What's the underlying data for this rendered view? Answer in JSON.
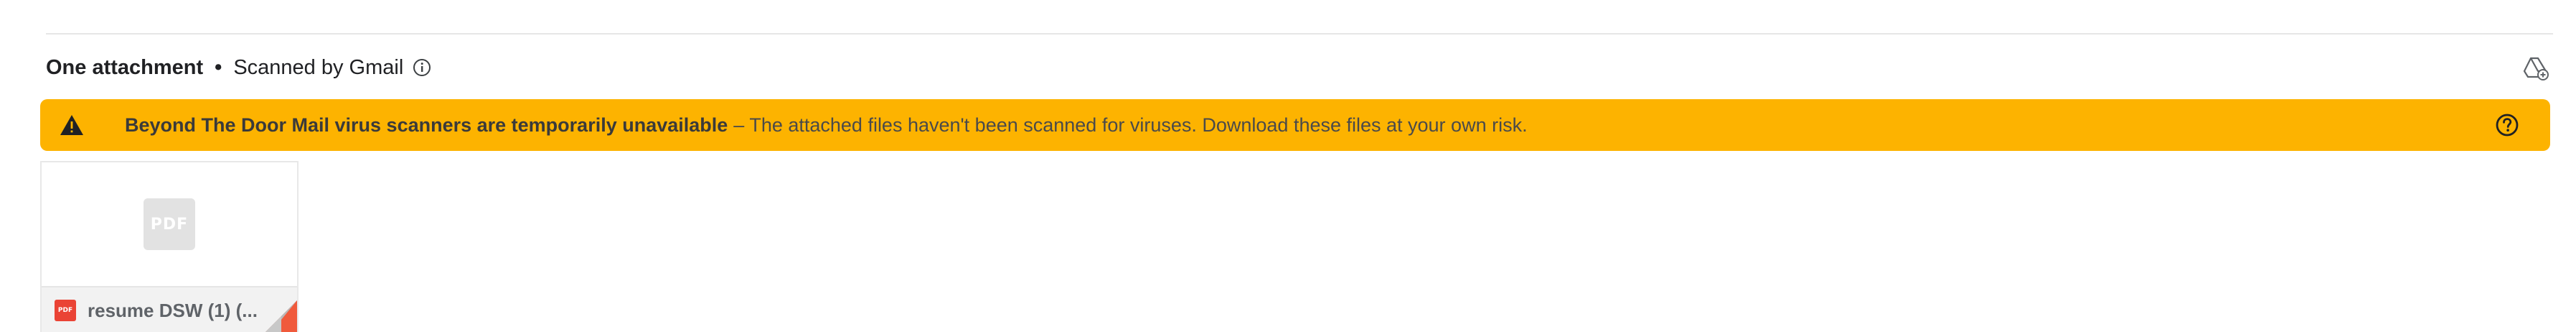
{
  "attachments_header": {
    "count_label": "One attachment",
    "separator": "•",
    "scanned_label": "Scanned by Gmail",
    "info_icon": "info-icon",
    "add_to_drive_icon": "add-to-drive-icon"
  },
  "warning_banner": {
    "title": "Beyond The Door Mail virus scanners are temporarily unavailable",
    "detail": "– The attached files haven't been scanned for viruses. Download these files at your own risk.",
    "background_color": "#fdb300",
    "warning_icon": "warning-triangle-icon",
    "help_icon": "help-circle-icon"
  },
  "attachment": {
    "placeholder_text": "PDF",
    "badge_text": "PDF",
    "file_name": "resume DSW (1) (...",
    "badge_color": "#ea4335"
  }
}
